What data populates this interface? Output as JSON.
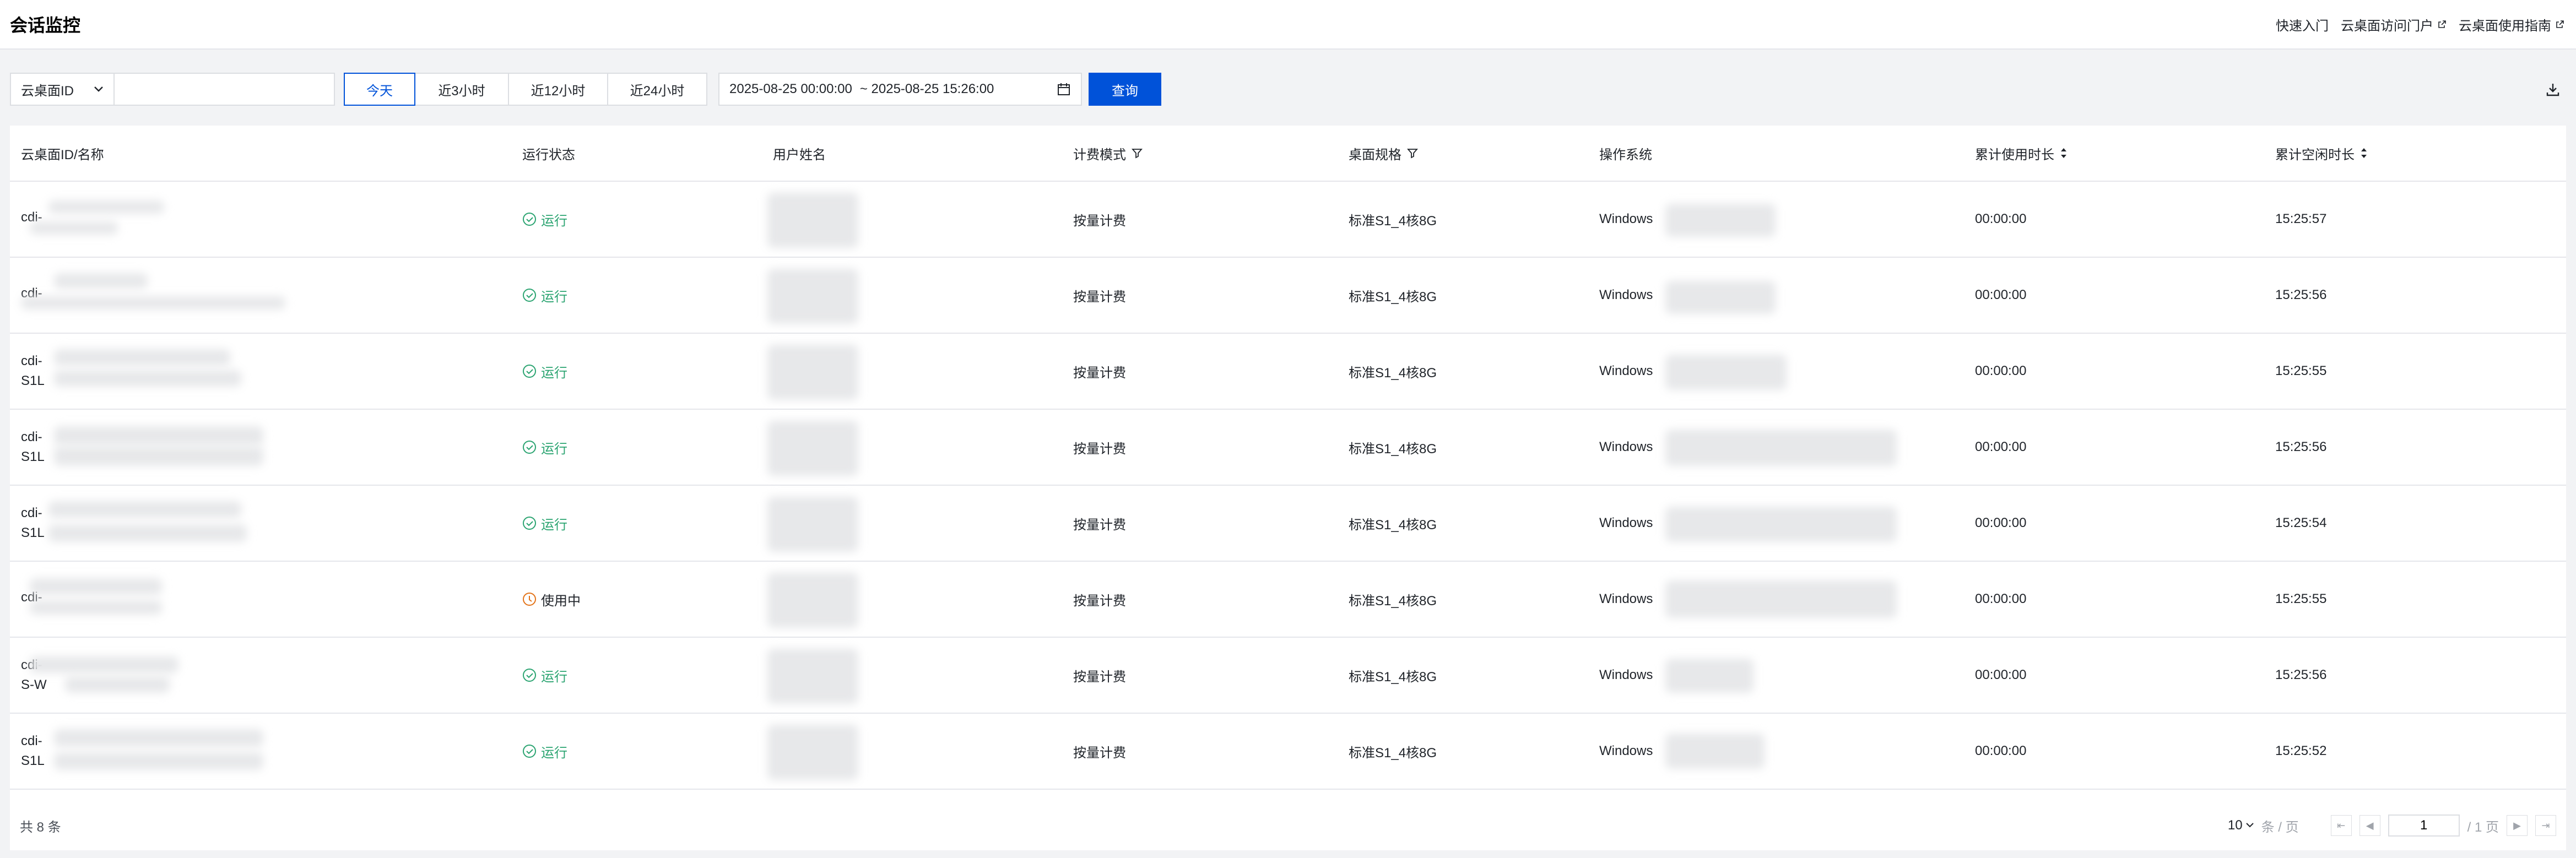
{
  "header": {
    "title": "会话监控",
    "links": [
      {
        "label": "快速入门",
        "external": false
      },
      {
        "label": "云桌面访问门户",
        "external": true
      },
      {
        "label": "云桌面使用指南",
        "external": true
      }
    ]
  },
  "filter": {
    "field_select": "云桌面ID",
    "search_value": "",
    "ranges": [
      "今天",
      "近3小时",
      "近12小时",
      "近24小时"
    ],
    "active_range": "今天",
    "date_start": "2025-08-25 00:00:00",
    "date_end": "~ 2025-08-25 15:26:00",
    "query_label": "查询"
  },
  "table": {
    "columns": [
      "云桌面ID/名称",
      "运行状态",
      "用户姓名",
      "计费模式",
      "桌面规格",
      "操作系统",
      "累计使用时长",
      "累计空闲时长"
    ],
    "rows": [
      {
        "id": "cdi-",
        "name": "",
        "status": "运行",
        "status_type": "run",
        "billing": "按量计费",
        "spec": "标准S1_4核8G",
        "os": "Windows",
        "used": "00:00:00",
        "idle": "15:25:57"
      },
      {
        "id": "cdi-",
        "name": "",
        "status": "运行",
        "status_type": "run",
        "billing": "按量计费",
        "spec": "标准S1_4核8G",
        "os": "Windows",
        "used": "00:00:00",
        "idle": "15:25:56"
      },
      {
        "id": "cdi-",
        "name": "S1L",
        "status": "运行",
        "status_type": "run",
        "billing": "按量计费",
        "spec": "标准S1_4核8G",
        "os": "Windows",
        "used": "00:00:00",
        "idle": "15:25:55"
      },
      {
        "id": "cdi-",
        "name": "S1L",
        "status": "运行",
        "status_type": "run",
        "billing": "按量计费",
        "spec": "标准S1_4核8G",
        "os": "Windows",
        "used": "00:00:00",
        "idle": "15:25:56"
      },
      {
        "id": "cdi-",
        "name": "S1L",
        "status": "运行",
        "status_type": "run",
        "billing": "按量计费",
        "spec": "标准S1_4核8G",
        "os": "Windows",
        "used": "00:00:00",
        "idle": "15:25:54"
      },
      {
        "id": "cdi-",
        "name": "",
        "status": "使用中",
        "status_type": "use",
        "billing": "按量计费",
        "spec": "标准S1_4核8G",
        "os": "Windows",
        "used": "00:00:00",
        "idle": "15:25:55"
      },
      {
        "id": "cdi-",
        "name": "S-W",
        "status": "运行",
        "status_type": "run",
        "billing": "按量计费",
        "spec": "标准S1_4核8G",
        "os": "Windows",
        "used": "00:00:00",
        "idle": "15:25:56"
      },
      {
        "id": "cdi-",
        "name": "S1L",
        "status": "运行",
        "status_type": "run",
        "billing": "按量计费",
        "spec": "标准S1_4核8G",
        "os": "Windows",
        "used": "00:00:00",
        "idle": "15:25:52"
      }
    ]
  },
  "footer": {
    "total": "共 8 条",
    "page_size": "10",
    "page_size_unit": "条 / 页",
    "current_page": "1",
    "total_pages": "/ 1 页"
  },
  "colors": {
    "primary": "#0052d9",
    "success": "#2ba471",
    "warning": "#e37318"
  }
}
